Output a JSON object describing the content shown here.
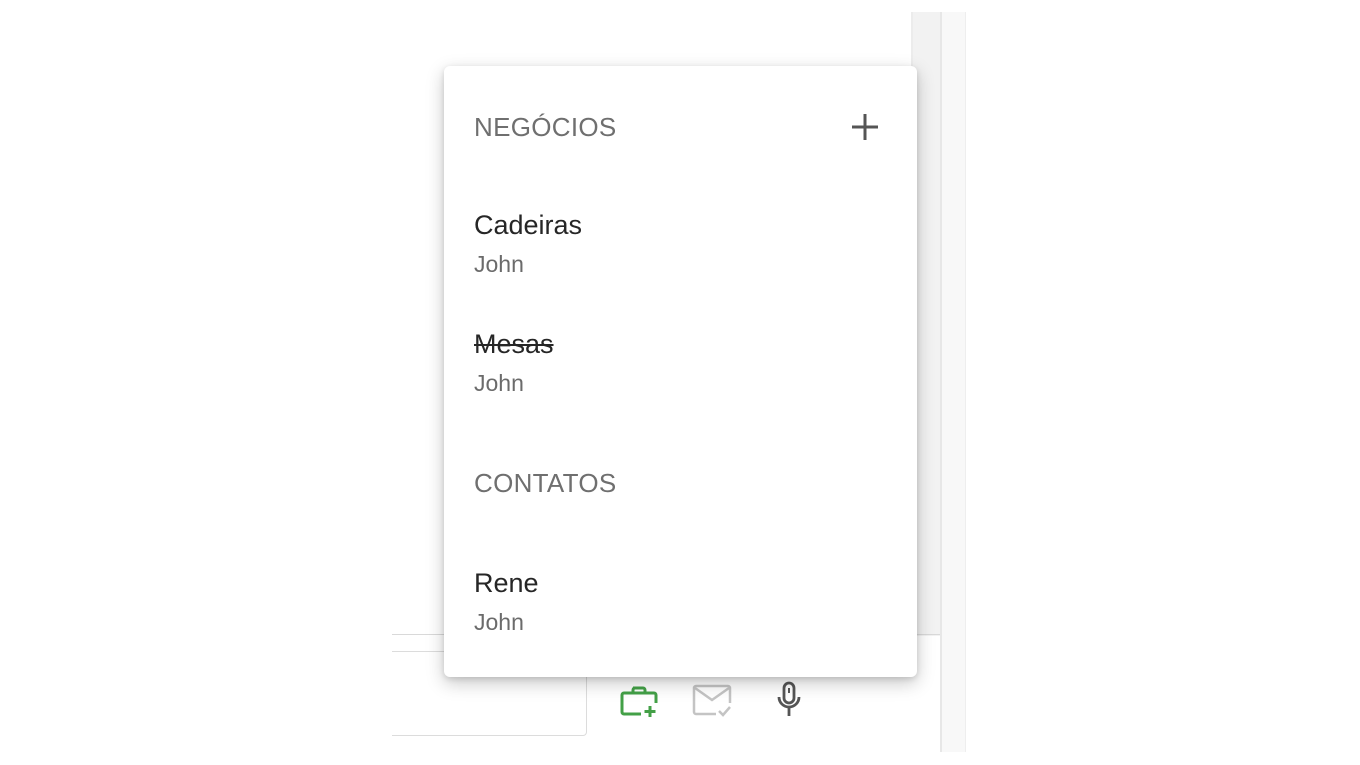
{
  "popup": {
    "sections": [
      {
        "header": "NEGÓCIOS",
        "add_icon": "plus-icon",
        "items": [
          {
            "title": "Cadeiras",
            "subtitle": "John",
            "struck": false
          },
          {
            "title": "Mesas",
            "subtitle": "John",
            "struck": true
          }
        ]
      },
      {
        "header": "CONTATOS",
        "items": [
          {
            "title": "Rene",
            "subtitle": "John",
            "struck": false
          }
        ]
      }
    ]
  },
  "toolbar": {
    "icons": [
      "briefcase-add-icon",
      "mail-check-icon",
      "microphone-icon"
    ]
  },
  "colors": {
    "accent_green": "#43a047",
    "icon_gray": "#bdbdbd",
    "icon_dark": "#555555",
    "header_text": "#6f6f6f",
    "title_text": "#262626"
  }
}
